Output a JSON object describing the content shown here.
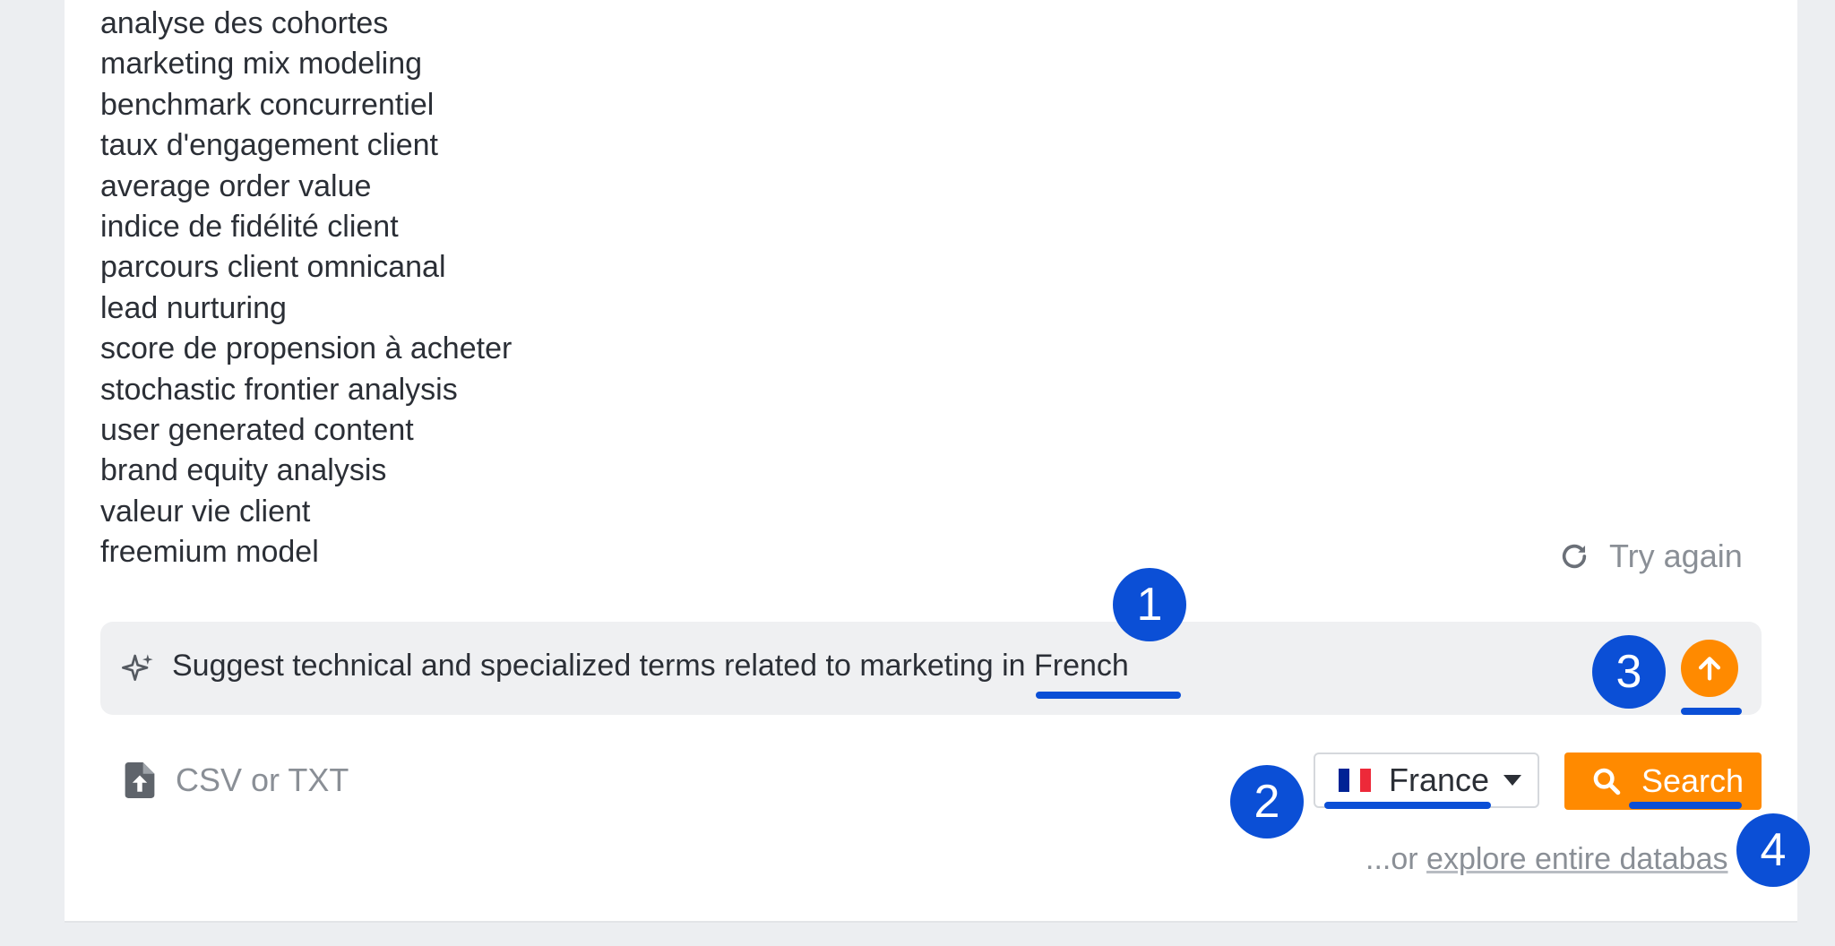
{
  "terms": [
    "analyse des cohortes",
    "marketing mix modeling",
    "benchmark concurrentiel",
    "taux d'engagement client",
    "average order value",
    "indice de fidélité client",
    "parcours client omnicanal",
    "lead nurturing",
    "score de propension à acheter",
    "stochastic frontier analysis",
    "user generated content",
    "brand equity analysis",
    "valeur vie client",
    "freemium model"
  ],
  "try_again": {
    "label": "Try again",
    "icon": "refresh-icon"
  },
  "prompt": {
    "text_before": "Suggest technical and specialized terms related to marketing ",
    "text_highlight": "in French",
    "icon": "sparkle-icon",
    "send_icon": "arrow-up-icon"
  },
  "upload": {
    "label": "CSV or TXT",
    "icon": "file-upload-icon"
  },
  "country": {
    "label": "France",
    "flag_colors": [
      "#002395",
      "#ffffff",
      "#ed2939"
    ]
  },
  "search_button": {
    "label": "Search",
    "icon": "search-icon"
  },
  "explore": {
    "prefix": "...or ",
    "link": "explore entire databas"
  },
  "badges": [
    "1",
    "2",
    "3",
    "4"
  ],
  "colors": {
    "accent": "#ff8a00",
    "annotation": "#0b4fd6",
    "muted": "#8a8f96"
  }
}
